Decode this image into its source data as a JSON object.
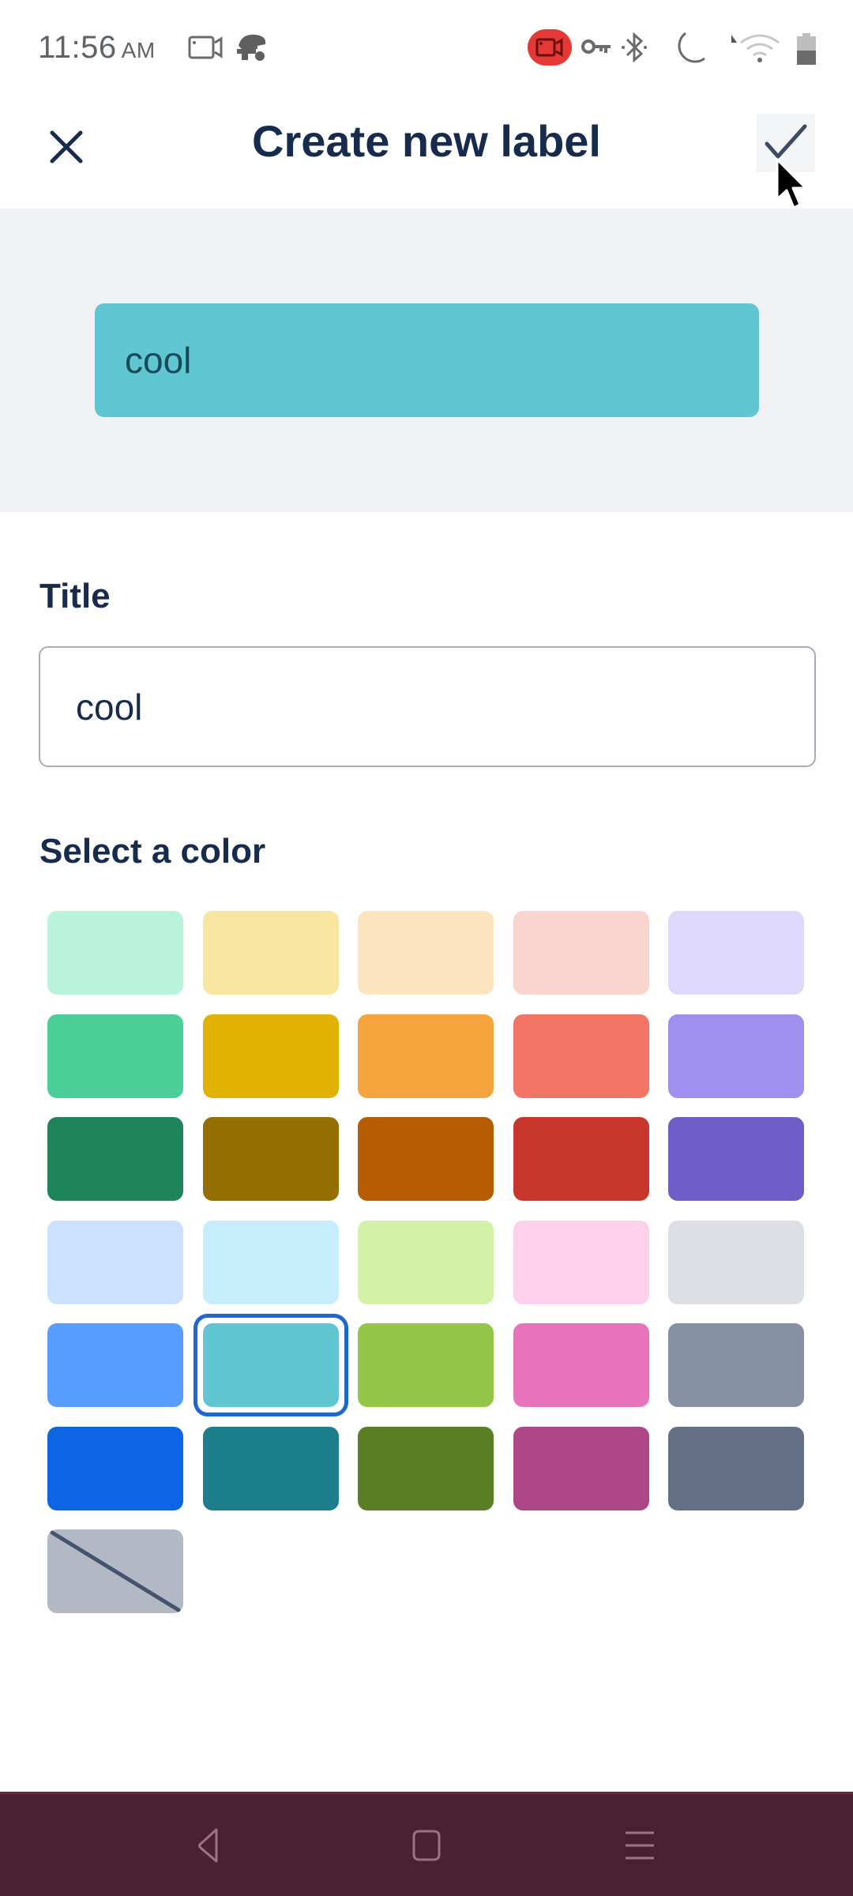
{
  "status_bar": {
    "time": "11:56",
    "ampm": "AM",
    "icons": [
      "screen-record-icon",
      "bag-icon",
      "recording-indicator-icon",
      "vpn-key-icon",
      "bluetooth-icon",
      "do-not-disturb-icon",
      "wifi-icon",
      "battery-icon"
    ]
  },
  "header": {
    "title": "Create new label",
    "close_icon": "close-icon",
    "confirm_icon": "checkmark-icon"
  },
  "preview": {
    "label_text": "cool",
    "label_color": "#60c6d2"
  },
  "form": {
    "title_label": "Title",
    "title_value": "cool",
    "color_label": "Select a color",
    "selected_color_index": 21,
    "colors": [
      {
        "name": "green-subtle",
        "hex": "#baf3db"
      },
      {
        "name": "yellow-subtle",
        "hex": "#f8e6a0"
      },
      {
        "name": "orange-subtle",
        "hex": "#fce4bf"
      },
      {
        "name": "red-subtle",
        "hex": "#fad4ce"
      },
      {
        "name": "purple-subtle",
        "hex": "#dfd8fd"
      },
      {
        "name": "green",
        "hex": "#4bce97"
      },
      {
        "name": "yellow",
        "hex": "#e2b203"
      },
      {
        "name": "orange",
        "hex": "#f5a43e"
      },
      {
        "name": "red",
        "hex": "#f37566"
      },
      {
        "name": "purple",
        "hex": "#9f8fef"
      },
      {
        "name": "green-bold",
        "hex": "#1f845a"
      },
      {
        "name": "yellow-bold",
        "hex": "#946f00"
      },
      {
        "name": "orange-bold",
        "hex": "#b65c02"
      },
      {
        "name": "red-bold",
        "hex": "#c9372c"
      },
      {
        "name": "purple-bold",
        "hex": "#6e5dc6"
      },
      {
        "name": "blue-subtle",
        "hex": "#cce0ff"
      },
      {
        "name": "sky-subtle",
        "hex": "#c6edfb"
      },
      {
        "name": "lime-subtle",
        "hex": "#d3f1a7"
      },
      {
        "name": "pink-subtle",
        "hex": "#fdd0ec"
      },
      {
        "name": "black-subtle",
        "hex": "#dcdfe4"
      },
      {
        "name": "blue",
        "hex": "#579dff"
      },
      {
        "name": "sky",
        "hex": "#60c6d2"
      },
      {
        "name": "lime",
        "hex": "#94c748"
      },
      {
        "name": "pink",
        "hex": "#e774bb"
      },
      {
        "name": "black",
        "hex": "#8590a2"
      },
      {
        "name": "blue-bold",
        "hex": "#0c66e4"
      },
      {
        "name": "sky-bold",
        "hex": "#1d7f8c"
      },
      {
        "name": "lime-bold",
        "hex": "#5b7f24"
      },
      {
        "name": "pink-bold",
        "hex": "#ae4787"
      },
      {
        "name": "black-bold",
        "hex": "#626f86"
      },
      {
        "name": "no-color",
        "hex": "#b3b9c4"
      }
    ]
  },
  "nav_bar": {
    "buttons": [
      "back",
      "home",
      "recents"
    ]
  }
}
